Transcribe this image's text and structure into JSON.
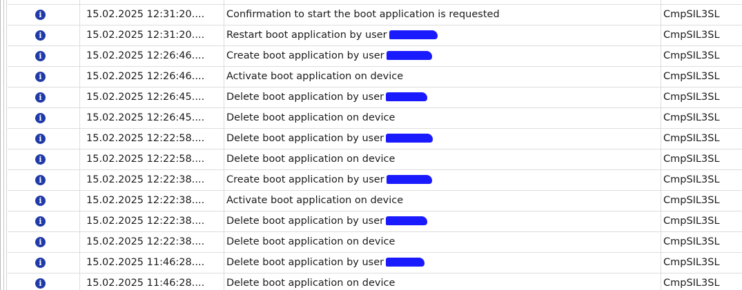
{
  "rows": [
    {
      "icon": "info-icon",
      "time": "15.02.2025 12:31:20....",
      "message": "Confirmation to start the boot application is requested",
      "component": "CmpSIL3SL",
      "redacted": false
    },
    {
      "icon": "info-icon",
      "time": "15.02.2025 12:31:20....",
      "message": "Restart boot application by user",
      "component": "CmpSIL3SL",
      "redacted": true,
      "redact_w": 70
    },
    {
      "icon": "info-icon",
      "time": "15.02.2025 12:26:46....",
      "message": "Create boot application by user",
      "component": "CmpSIL3SL",
      "redacted": true,
      "redact_w": 66
    },
    {
      "icon": "info-icon",
      "time": "15.02.2025 12:26:46....",
      "message": "Activate boot application on device",
      "component": "CmpSIL3SL",
      "redacted": false
    },
    {
      "icon": "info-icon",
      "time": "15.02.2025 12:26:45....",
      "message": "Delete boot application by user",
      "component": "CmpSIL3SL",
      "redacted": true,
      "redact_w": 60
    },
    {
      "icon": "info-icon",
      "time": "15.02.2025 12:26:45....",
      "message": "Delete boot application on device",
      "component": "CmpSIL3SL",
      "redacted": false
    },
    {
      "icon": "info-icon",
      "time": "15.02.2025 12:22:58....",
      "message": "Delete boot application by user",
      "component": "CmpSIL3SL",
      "redacted": true,
      "redact_w": 68
    },
    {
      "icon": "info-icon",
      "time": "15.02.2025 12:22:58....",
      "message": "Delete boot application on device",
      "component": "CmpSIL3SL",
      "redacted": false
    },
    {
      "icon": "info-icon",
      "time": "15.02.2025 12:22:38....",
      "message": "Create boot application by user",
      "component": "CmpSIL3SL",
      "redacted": true,
      "redact_w": 66
    },
    {
      "icon": "info-icon",
      "time": "15.02.2025 12:22:38....",
      "message": "Activate boot application on device",
      "component": "CmpSIL3SL",
      "redacted": false
    },
    {
      "icon": "info-icon",
      "time": "15.02.2025 12:22:38....",
      "message": "Delete boot application by user",
      "component": "CmpSIL3SL",
      "redacted": true,
      "redact_w": 60
    },
    {
      "icon": "info-icon",
      "time": "15.02.2025 12:22:38....",
      "message": "Delete boot application on device",
      "component": "CmpSIL3SL",
      "redacted": false
    },
    {
      "icon": "info-icon",
      "time": "15.02.2025 11:46:28....",
      "message": "Delete boot application by user",
      "component": "CmpSIL3SL",
      "redacted": true,
      "redact_w": 56
    },
    {
      "icon": "info-icon",
      "time": "15.02.2025 11:46:28....",
      "message": "Delete boot application on device",
      "component": "CmpSIL3SL",
      "redacted": false
    }
  ],
  "colors": {
    "info_icon": "#1f3aa8",
    "redaction": "#1a1aff",
    "grid": "#dcdcdc"
  }
}
